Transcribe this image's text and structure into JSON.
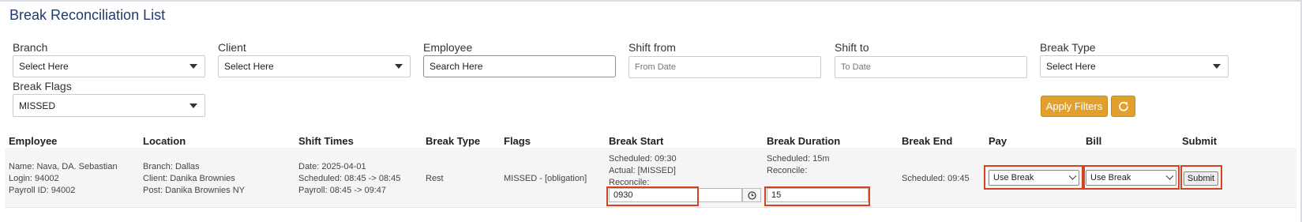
{
  "page": {
    "title": "Break Reconciliation List"
  },
  "filters": {
    "branch": {
      "label": "Branch",
      "value": "Select Here"
    },
    "client": {
      "label": "Client",
      "value": "Select Here"
    },
    "employee": {
      "label": "Employee",
      "placeholder": "Search Here"
    },
    "shift_from": {
      "label": "Shift from",
      "placeholder": "From Date"
    },
    "shift_to": {
      "label": "Shift to",
      "placeholder": "To Date"
    },
    "break_type": {
      "label": "Break Type",
      "value": "Select Here"
    },
    "break_flags": {
      "label": "Break Flags",
      "value": "MISSED"
    },
    "apply_label": "Apply Filters",
    "refresh_icon": "refresh-icon"
  },
  "table": {
    "headers": {
      "employee": "Employee",
      "location": "Location",
      "shift_times": "Shift Times",
      "break_type": "Break Type",
      "flags": "Flags",
      "break_start": "Break Start",
      "break_duration": "Break Duration",
      "break_end": "Break End",
      "pay": "Pay",
      "bill": "Bill",
      "submit": "Submit"
    },
    "rows": [
      {
        "employee": {
          "name": "Name: Nava, DA. Sebastian",
          "login": "Login: 94002",
          "payroll": "Payroll ID: 94002"
        },
        "location": {
          "branch": "Branch: Dallas",
          "client": "Client: Danika Brownies",
          "post": "Post: Danika Brownies NY"
        },
        "shift": {
          "date": "Date: 2025-04-01",
          "scheduled": "Scheduled: 08:45 -> 08:45",
          "payroll": "Payroll: 08:45 -> 09:47"
        },
        "break_type": "Rest",
        "flags": "MISSED - [obligation]",
        "break_start": {
          "scheduled": "Scheduled: 09:30",
          "actual": "Actual: [MISSED]",
          "reconcile": "Reconcile:",
          "input_value": "0930"
        },
        "break_duration": {
          "scheduled": "Scheduled: 15m",
          "reconcile": "Reconcile:",
          "input_value": "15"
        },
        "break_end": "Scheduled: 09:45",
        "pay": "Use Break",
        "bill": "Use Break",
        "submit_label": "Submit"
      }
    ]
  },
  "colors": {
    "accent": "#e0a02b",
    "highlight": "#d2441f",
    "title": "#1f3a6b"
  }
}
